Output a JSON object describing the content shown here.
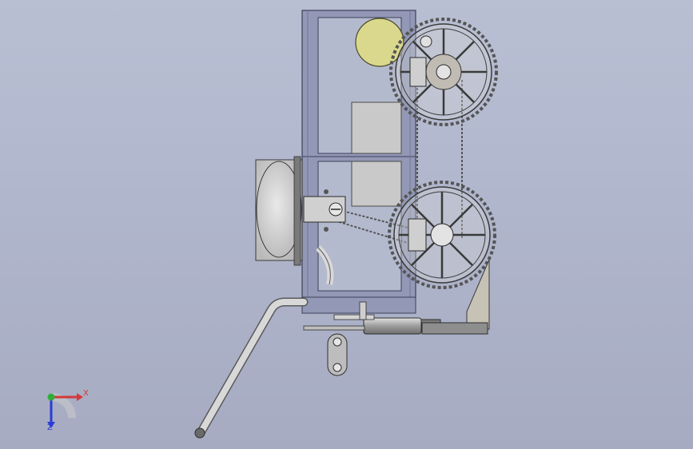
{
  "scene": {
    "description_hidden": false,
    "colors": {
      "background": "#b4bace",
      "frame": "#8c92b2",
      "metal": "#d4d4d4",
      "dark_metal": "#5a5a5a",
      "motor_yellow": "#d9d78a",
      "gray_panel": "#c6c6c6"
    }
  },
  "triad": {
    "x_label": "X",
    "z_label": "Z",
    "x_color": "#d23a3a",
    "y_color": "#2fae3a",
    "z_color": "#2b3bd6"
  }
}
